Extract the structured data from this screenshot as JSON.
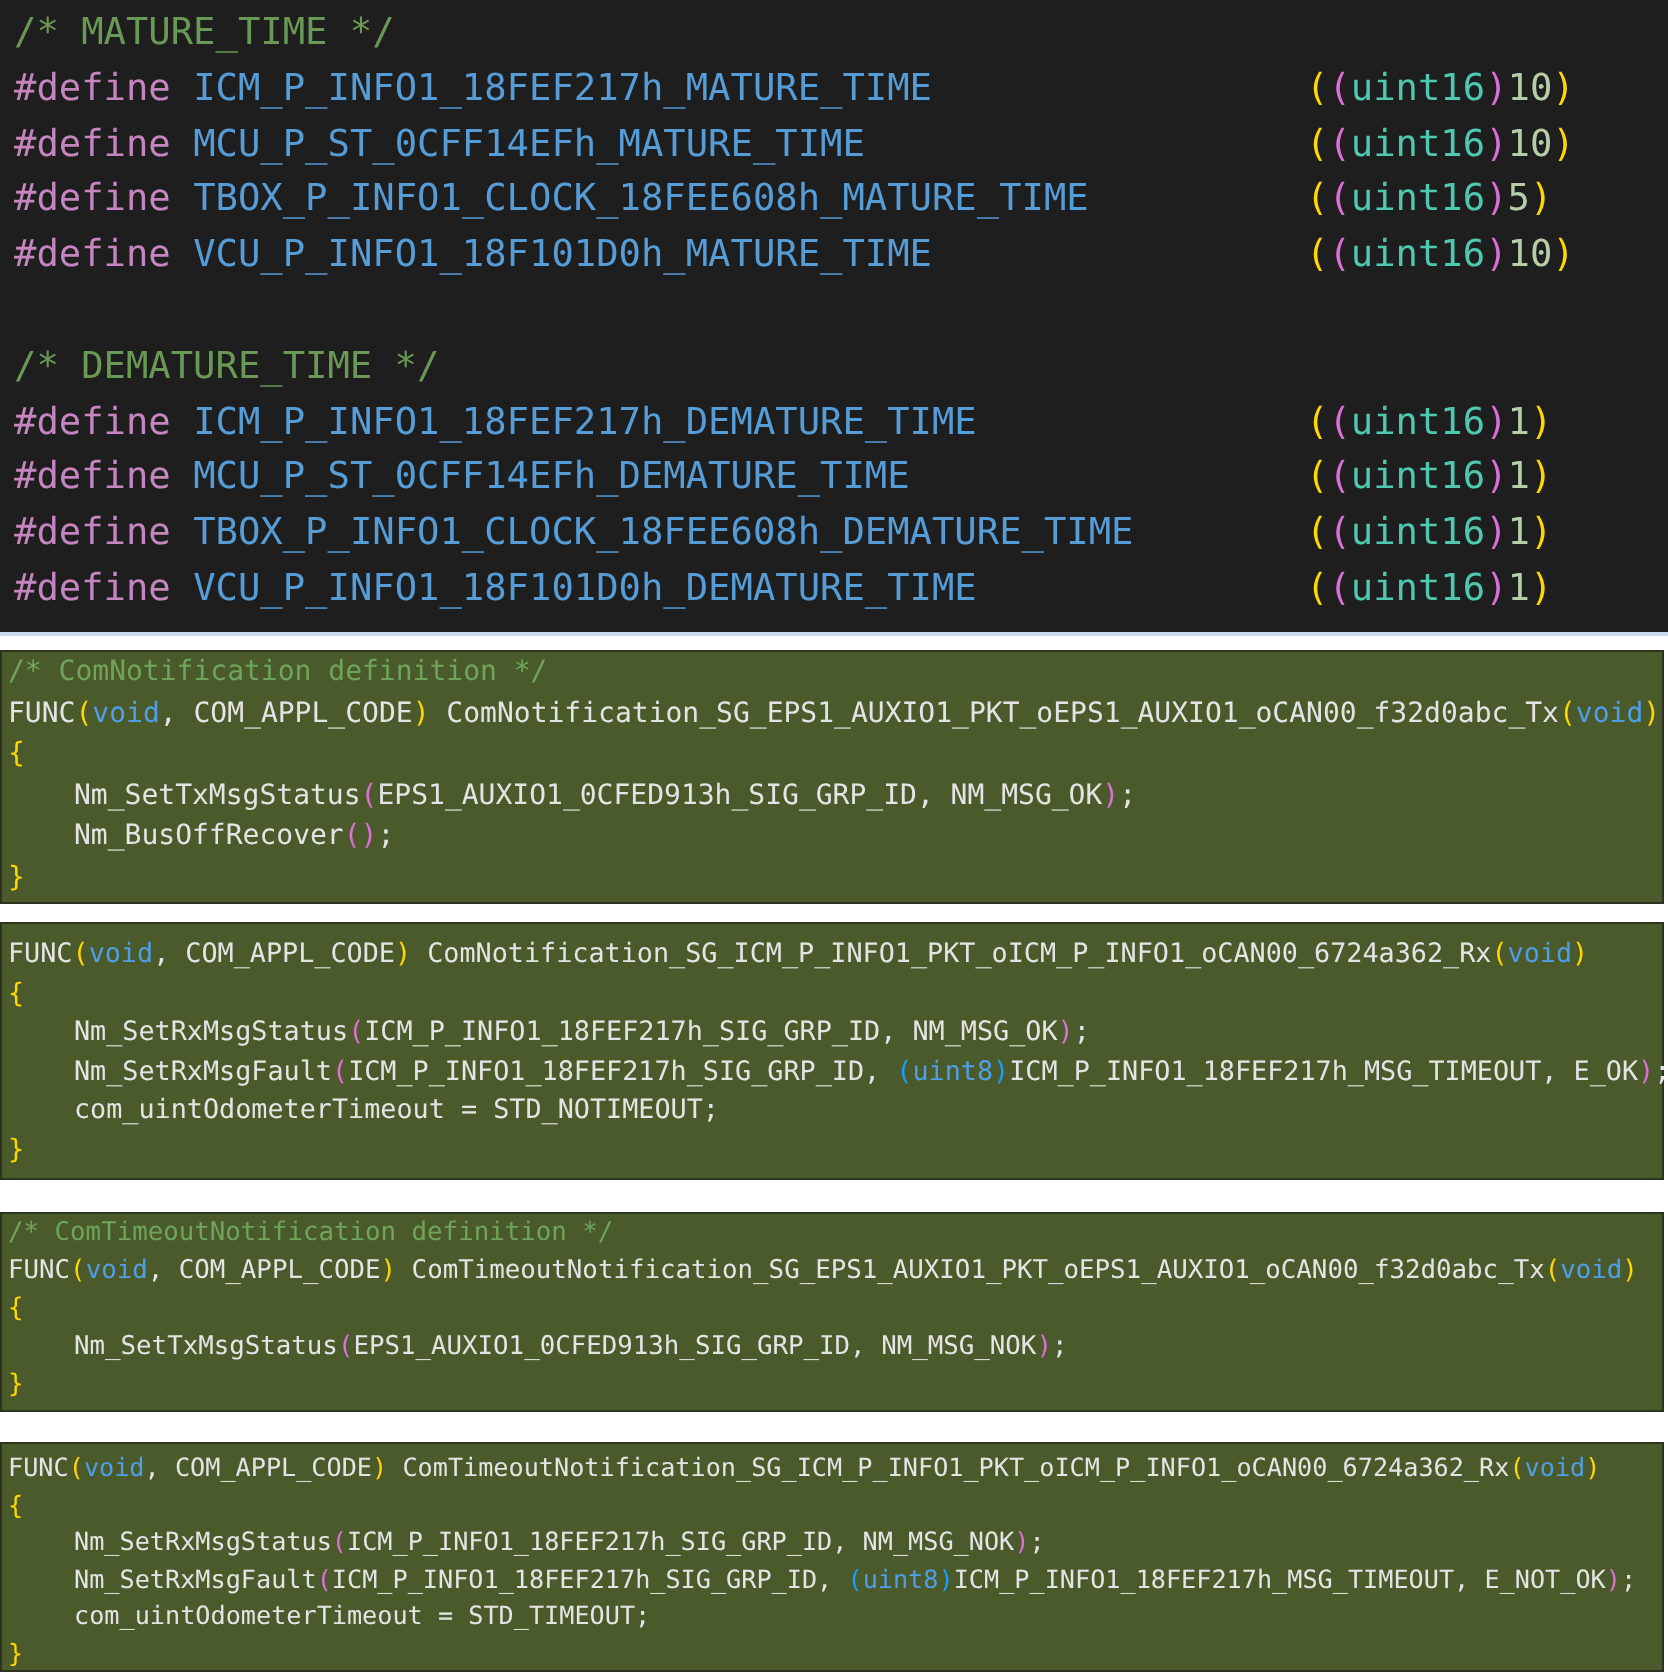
{
  "define_groups": [
    {
      "comment": "/* MATURE_TIME */",
      "defines": [
        {
          "directive": "#define",
          "name": "ICM_P_INFO1_18FEF217h_MATURE_TIME",
          "value": [
            {
              "text": "(",
              "kind": "b1"
            },
            {
              "text": "(",
              "kind": "b2"
            },
            {
              "text": "uint16",
              "kind": "type"
            },
            {
              "text": ")",
              "kind": "b2"
            },
            {
              "text": "10",
              "kind": "number"
            },
            {
              "text": ")",
              "kind": "b1"
            }
          ]
        },
        {
          "directive": "#define",
          "name": "MCU_P_ST_0CFF14EFh_MATURE_TIME",
          "value": [
            {
              "text": "(",
              "kind": "b1"
            },
            {
              "text": "(",
              "kind": "b2"
            },
            {
              "text": "uint16",
              "kind": "type"
            },
            {
              "text": ")",
              "kind": "b2"
            },
            {
              "text": "10",
              "kind": "number"
            },
            {
              "text": ")",
              "kind": "b1"
            }
          ]
        },
        {
          "directive": "#define",
          "name": "TBOX_P_INFO1_CLOCK_18FEE608h_MATURE_TIME",
          "value": [
            {
              "text": "(",
              "kind": "b1"
            },
            {
              "text": "(",
              "kind": "b2"
            },
            {
              "text": "uint16",
              "kind": "type"
            },
            {
              "text": ")",
              "kind": "b2"
            },
            {
              "text": "5",
              "kind": "number"
            },
            {
              "text": ")",
              "kind": "b1"
            }
          ]
        },
        {
          "directive": "#define",
          "name": "VCU_P_INFO1_18F101D0h_MATURE_TIME",
          "value": [
            {
              "text": "(",
              "kind": "b1"
            },
            {
              "text": "(",
              "kind": "b2"
            },
            {
              "text": "uint16",
              "kind": "type"
            },
            {
              "text": ")",
              "kind": "b2"
            },
            {
              "text": "10",
              "kind": "number"
            },
            {
              "text": ")",
              "kind": "b1"
            }
          ]
        }
      ]
    },
    {
      "comment": "/* DEMATURE_TIME */",
      "defines": [
        {
          "directive": "#define",
          "name": "ICM_P_INFO1_18FEF217h_DEMATURE_TIME",
          "value": [
            {
              "text": "(",
              "kind": "b1"
            },
            {
              "text": "(",
              "kind": "b2"
            },
            {
              "text": "uint16",
              "kind": "type"
            },
            {
              "text": ")",
              "kind": "b2"
            },
            {
              "text": "1",
              "kind": "number"
            },
            {
              "text": ")",
              "kind": "b1"
            }
          ]
        },
        {
          "directive": "#define",
          "name": "MCU_P_ST_0CFF14EFh_DEMATURE_TIME",
          "value": [
            {
              "text": "(",
              "kind": "b1"
            },
            {
              "text": "(",
              "kind": "b2"
            },
            {
              "text": "uint16",
              "kind": "type"
            },
            {
              "text": ")",
              "kind": "b2"
            },
            {
              "text": "1",
              "kind": "number"
            },
            {
              "text": ")",
              "kind": "b1"
            }
          ]
        },
        {
          "directive": "#define",
          "name": "TBOX_P_INFO1_CLOCK_18FEE608h_DEMATURE_TIME",
          "value": [
            {
              "text": "(",
              "kind": "b1"
            },
            {
              "text": "(",
              "kind": "b2"
            },
            {
              "text": "uint16",
              "kind": "type"
            },
            {
              "text": ")",
              "kind": "b2"
            },
            {
              "text": "1",
              "kind": "number"
            },
            {
              "text": ")",
              "kind": "b1"
            }
          ]
        },
        {
          "directive": "#define",
          "name": "VCU_P_INFO1_18F101D0h_DEMATURE_TIME",
          "value": [
            {
              "text": "(",
              "kind": "b1"
            },
            {
              "text": "(",
              "kind": "b2"
            },
            {
              "text": "uint16",
              "kind": "type"
            },
            {
              "text": ")",
              "kind": "b2"
            },
            {
              "text": "1",
              "kind": "number"
            },
            {
              "text": ")",
              "kind": "b1"
            }
          ]
        }
      ]
    }
  ],
  "code_panels": [
    {
      "lines": [
        {
          "indented": false,
          "tokens": [
            {
              "text": "/* ComNotification definition */",
              "kind": "comment"
            }
          ]
        },
        {
          "indented": false,
          "tokens": [
            {
              "text": "FUNC",
              "kind": "plain"
            },
            {
              "text": "(",
              "kind": "b1"
            },
            {
              "text": "void",
              "kind": "keyword"
            },
            {
              "text": ", COM_APPL_CODE",
              "kind": "plain"
            },
            {
              "text": ")",
              "kind": "b1"
            },
            {
              "text": " ComNotification_SG_EPS1_AUXIO1_PKT_oEPS1_AUXIO1_oCAN00_f32d0abc_Tx",
              "kind": "plain"
            },
            {
              "text": "(",
              "kind": "b1"
            },
            {
              "text": "void",
              "kind": "keyword"
            },
            {
              "text": ")",
              "kind": "b1"
            }
          ]
        },
        {
          "indented": false,
          "tokens": [
            {
              "text": "{",
              "kind": "b1"
            }
          ]
        },
        {
          "indented": true,
          "tokens": [
            {
              "text": "Nm_SetTxMsgStatus",
              "kind": "plain"
            },
            {
              "text": "(",
              "kind": "b2"
            },
            {
              "text": "EPS1_AUXIO1_0CFED913h_SIG_GRP_ID, NM_MSG_OK",
              "kind": "plain"
            },
            {
              "text": ")",
              "kind": "b2"
            },
            {
              "text": ";",
              "kind": "plain"
            }
          ]
        },
        {
          "indented": true,
          "tokens": [
            {
              "text": "Nm_BusOffRecover",
              "kind": "plain"
            },
            {
              "text": "(",
              "kind": "b2"
            },
            {
              "text": ")",
              "kind": "b2"
            },
            {
              "text": ";",
              "kind": "plain"
            }
          ]
        },
        {
          "indented": false,
          "tokens": [
            {
              "text": "}",
              "kind": "b1"
            }
          ]
        }
      ]
    },
    {
      "lines": [
        {
          "indented": false,
          "tokens": [
            {
              "text": "FUNC",
              "kind": "plain"
            },
            {
              "text": "(",
              "kind": "b1"
            },
            {
              "text": "void",
              "kind": "keyword"
            },
            {
              "text": ", COM_APPL_CODE",
              "kind": "plain"
            },
            {
              "text": ")",
              "kind": "b1"
            },
            {
              "text": " ComNotification_SG_ICM_P_INFO1_PKT_oICM_P_INFO1_oCAN00_6724a362_Rx",
              "kind": "plain"
            },
            {
              "text": "(",
              "kind": "b1"
            },
            {
              "text": "void",
              "kind": "keyword"
            },
            {
              "text": ")",
              "kind": "b1"
            }
          ]
        },
        {
          "indented": false,
          "tokens": [
            {
              "text": "{",
              "kind": "b1"
            }
          ]
        },
        {
          "indented": true,
          "tokens": [
            {
              "text": "Nm_SetRxMsgStatus",
              "kind": "plain"
            },
            {
              "text": "(",
              "kind": "b2"
            },
            {
              "text": "ICM_P_INFO1_18FEF217h_SIG_GRP_ID, NM_MSG_OK",
              "kind": "plain"
            },
            {
              "text": ")",
              "kind": "b2"
            },
            {
              "text": ";",
              "kind": "plain"
            }
          ]
        },
        {
          "indented": true,
          "tokens": [
            {
              "text": "Nm_SetRxMsgFault",
              "kind": "plain"
            },
            {
              "text": "(",
              "kind": "b2"
            },
            {
              "text": "ICM_P_INFO1_18FEF217h_SIG_GRP_ID, ",
              "kind": "plain"
            },
            {
              "text": "(",
              "kind": "b3"
            },
            {
              "text": "uint8",
              "kind": "keyword"
            },
            {
              "text": ")",
              "kind": "b3"
            },
            {
              "text": "ICM_P_INFO1_18FEF217h_MSG_TIMEOUT, E_OK",
              "kind": "plain"
            },
            {
              "text": ")",
              "kind": "b2"
            },
            {
              "text": ";",
              "kind": "plain"
            }
          ]
        },
        {
          "indented": true,
          "tokens": [
            {
              "text": "com_uintOdometerTimeout = STD_NOTIMEOUT;",
              "kind": "plain"
            }
          ]
        },
        {
          "indented": false,
          "tokens": [
            {
              "text": "}",
              "kind": "b1"
            }
          ]
        }
      ]
    },
    {
      "lines": [
        {
          "indented": false,
          "tokens": [
            {
              "text": "/* ComTimeoutNotification definition */",
              "kind": "comment"
            }
          ]
        },
        {
          "indented": false,
          "tokens": [
            {
              "text": "FUNC",
              "kind": "plain"
            },
            {
              "text": "(",
              "kind": "b1"
            },
            {
              "text": "void",
              "kind": "keyword"
            },
            {
              "text": ", COM_APPL_CODE",
              "kind": "plain"
            },
            {
              "text": ")",
              "kind": "b1"
            },
            {
              "text": " ComTimeoutNotification_SG_EPS1_AUXIO1_PKT_oEPS1_AUXIO1_oCAN00_f32d0abc_Tx",
              "kind": "plain"
            },
            {
              "text": "(",
              "kind": "b1"
            },
            {
              "text": "void",
              "kind": "keyword"
            },
            {
              "text": ")",
              "kind": "b1"
            }
          ]
        },
        {
          "indented": false,
          "tokens": [
            {
              "text": "{",
              "kind": "b1"
            }
          ]
        },
        {
          "indented": true,
          "tokens": [
            {
              "text": "Nm_SetTxMsgStatus",
              "kind": "plain"
            },
            {
              "text": "(",
              "kind": "b2"
            },
            {
              "text": "EPS1_AUXIO1_0CFED913h_SIG_GRP_ID, NM_MSG_NOK",
              "kind": "plain"
            },
            {
              "text": ")",
              "kind": "b2"
            },
            {
              "text": ";",
              "kind": "plain"
            }
          ]
        },
        {
          "indented": false,
          "tokens": [
            {
              "text": "}",
              "kind": "b1"
            }
          ]
        }
      ]
    },
    {
      "lines": [
        {
          "indented": false,
          "tokens": [
            {
              "text": "FUNC",
              "kind": "plain"
            },
            {
              "text": "(",
              "kind": "b1"
            },
            {
              "text": "void",
              "kind": "keyword"
            },
            {
              "text": ", COM_APPL_CODE",
              "kind": "plain"
            },
            {
              "text": ")",
              "kind": "b1"
            },
            {
              "text": " ComTimeoutNotification_SG_ICM_P_INFO1_PKT_oICM_P_INFO1_oCAN00_6724a362_Rx",
              "kind": "plain"
            },
            {
              "text": "(",
              "kind": "b1"
            },
            {
              "text": "void",
              "kind": "keyword"
            },
            {
              "text": ")",
              "kind": "b1"
            }
          ]
        },
        {
          "indented": false,
          "tokens": [
            {
              "text": "{",
              "kind": "b1"
            }
          ]
        },
        {
          "indented": true,
          "tokens": [
            {
              "text": "Nm_SetRxMsgStatus",
              "kind": "plain"
            },
            {
              "text": "(",
              "kind": "b2"
            },
            {
              "text": "ICM_P_INFO1_18FEF217h_SIG_GRP_ID, NM_MSG_NOK",
              "kind": "plain"
            },
            {
              "text": ")",
              "kind": "b2"
            },
            {
              "text": ";",
              "kind": "plain"
            }
          ]
        },
        {
          "indented": true,
          "tokens": [
            {
              "text": "Nm_SetRxMsgFault",
              "kind": "plain"
            },
            {
              "text": "(",
              "kind": "b2"
            },
            {
              "text": "ICM_P_INFO1_18FEF217h_SIG_GRP_ID, ",
              "kind": "plain"
            },
            {
              "text": "(",
              "kind": "b3"
            },
            {
              "text": "uint8",
              "kind": "keyword"
            },
            {
              "text": ")",
              "kind": "b3"
            },
            {
              "text": "ICM_P_INFO1_18FEF217h_MSG_TIMEOUT, E_NOT_OK",
              "kind": "plain"
            },
            {
              "text": ")",
              "kind": "b2"
            },
            {
              "text": ";",
              "kind": "plain"
            }
          ]
        },
        {
          "indented": true,
          "tokens": [
            {
              "text": "com_uintOdometerTimeout = STD_TIMEOUT;",
              "kind": "plain"
            }
          ]
        },
        {
          "indented": false,
          "tokens": [
            {
              "text": "}",
              "kind": "b1"
            }
          ]
        }
      ]
    }
  ]
}
